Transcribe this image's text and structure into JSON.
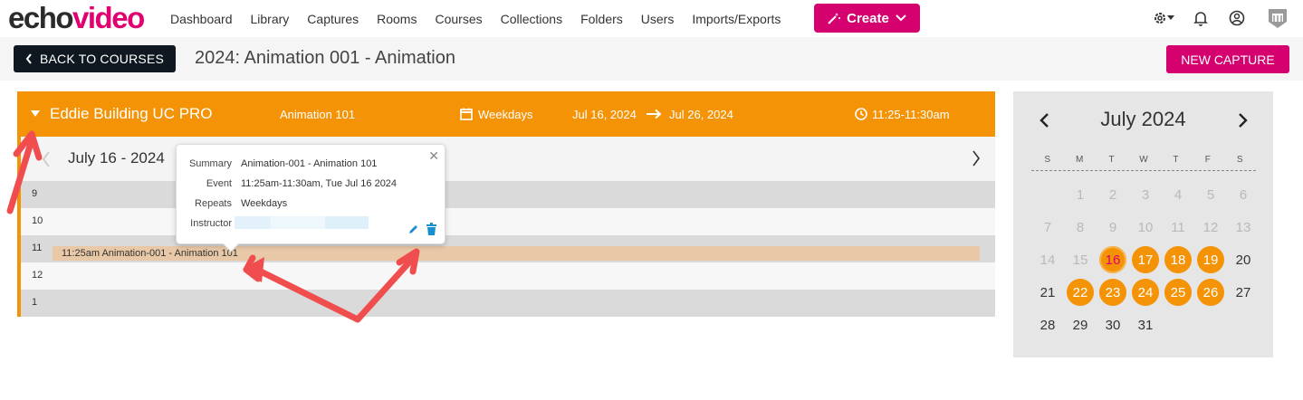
{
  "brand": {
    "echo": "echo",
    "video": "video"
  },
  "nav": {
    "links": [
      "Dashboard",
      "Library",
      "Captures",
      "Rooms",
      "Courses",
      "Collections",
      "Folders",
      "Users",
      "Imports/Exports"
    ],
    "create_label": "Create"
  },
  "subbar": {
    "back_label": "BACK TO COURSES",
    "title": "2024: Animation 001 - Animation",
    "new_capture_label": "NEW CAPTURE"
  },
  "schedule": {
    "room": "Eddie Building UC PRO",
    "section": "Animation 101",
    "repeats": "Weekdays",
    "start_date": "Jul 16, 2024",
    "end_date": "Jul 26, 2024",
    "time": "11:25-11:30am",
    "day_label": "July 16 - 2024",
    "hours": [
      "9",
      "10",
      "11",
      "12",
      "1"
    ],
    "event_label": "11:25am Animation-001 - Animation 101"
  },
  "popover": {
    "summary_key": "Summary",
    "summary": "Animation-001 - Animation 101",
    "event_key": "Event",
    "event": "11:25am-11:30am, Tue Jul 16 2024",
    "repeats_key": "Repeats",
    "repeats": "Weekdays",
    "instructor_key": "Instructor"
  },
  "calendar": {
    "title": "July 2024",
    "weekdays": [
      "S",
      "M",
      "T",
      "W",
      "T",
      "F",
      "S"
    ],
    "weeks": [
      [
        {
          "d": "1",
          "s": "muted"
        },
        {
          "d": "2",
          "s": "muted"
        },
        {
          "d": "3",
          "s": "muted"
        },
        {
          "d": "4",
          "s": "muted"
        },
        {
          "d": "5",
          "s": "muted"
        },
        {
          "d": "6",
          "s": "muted"
        }
      ],
      [
        {
          "d": "7",
          "s": "muted"
        },
        {
          "d": "8",
          "s": "muted"
        },
        {
          "d": "9",
          "s": "muted"
        },
        {
          "d": "10",
          "s": "muted"
        },
        {
          "d": "11",
          "s": "muted"
        },
        {
          "d": "12",
          "s": "muted"
        },
        {
          "d": "13",
          "s": "muted"
        }
      ],
      [
        {
          "d": "14",
          "s": "muted"
        },
        {
          "d": "15",
          "s": "muted"
        },
        {
          "d": "16",
          "s": "today"
        },
        {
          "d": "17",
          "s": "event"
        },
        {
          "d": "18",
          "s": "event"
        },
        {
          "d": "19",
          "s": "event"
        },
        {
          "d": "20",
          "s": "normal"
        }
      ],
      [
        {
          "d": "21",
          "s": "normal"
        },
        {
          "d": "22",
          "s": "event"
        },
        {
          "d": "23",
          "s": "event"
        },
        {
          "d": "24",
          "s": "event"
        },
        {
          "d": "25",
          "s": "event"
        },
        {
          "d": "26",
          "s": "event"
        },
        {
          "d": "27",
          "s": "normal"
        }
      ],
      [
        {
          "d": "28",
          "s": "normal"
        },
        {
          "d": "29",
          "s": "normal"
        },
        {
          "d": "30",
          "s": "normal"
        },
        {
          "d": "31",
          "s": "normal"
        }
      ]
    ]
  },
  "colors": {
    "accent": "#f49306",
    "brand": "#d4016f",
    "annotation": "#f04e4e"
  }
}
